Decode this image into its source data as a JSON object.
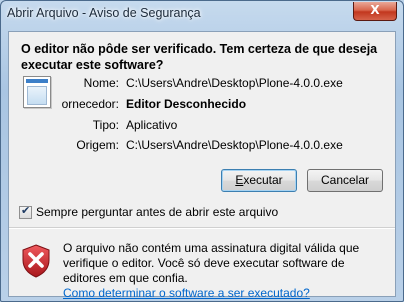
{
  "window": {
    "title": "Abrir Arquivo - Aviso de Segurança",
    "close_glyph": "X"
  },
  "dialog": {
    "heading": "O editor não pôde ser verificado. Tem certeza de que deseja executar este software?",
    "fields": [
      {
        "label": "Nome:",
        "value": "C:\\Users\\Andre\\Desktop\\Plone-4.0.0.exe"
      },
      {
        "label": "ornecedor:",
        "value": "Editor Desconhecido"
      },
      {
        "label": "Tipo:",
        "value": "Aplicativo"
      },
      {
        "label": "Origem:",
        "value": "C:\\Users\\Andre\\Desktop\\Plone-4.0.0.exe"
      }
    ],
    "file_icon": "application-window-icon"
  },
  "buttons": {
    "run_label_rest": "xecutar",
    "run_accesskey": "E",
    "cancel_label": "Cancelar"
  },
  "checkbox": {
    "label": "Sempre perguntar antes de abrir este arquivo",
    "checked": true
  },
  "warning": {
    "icon": "red-shield-x-icon",
    "text": "O arquivo não contém uma assinatura digital válida que verifique o editor. Você só deve executar software de editores em que confia.",
    "link": "Como determinar o software a ser executado?"
  },
  "colors": {
    "title_bar": "#a9c5e2",
    "close_button": "#c2371e",
    "link": "#0066cc",
    "shield_red": "#c8262b"
  }
}
